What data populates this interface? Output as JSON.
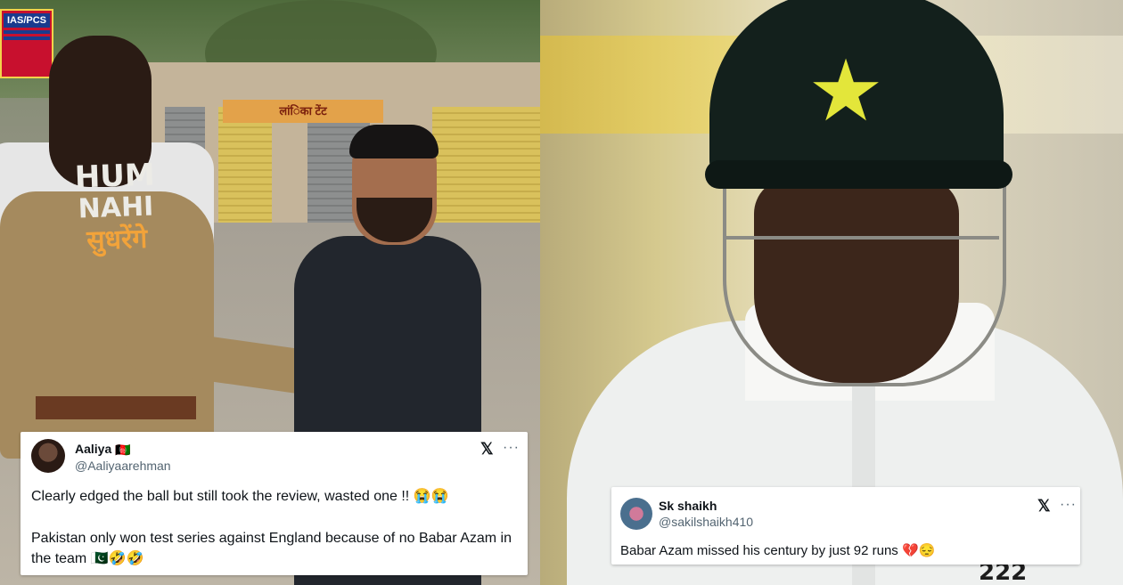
{
  "left_photo": {
    "ias_sign": [
      "IAS/PCS",
      "",
      ""
    ],
    "shop_sign": "लांिका टेंट",
    "tshirt": {
      "line1": "HUM",
      "line2": "NAHI",
      "line3": "सुधरेंगे"
    }
  },
  "right_photo": {
    "jersey_number": "222"
  },
  "tweets": [
    {
      "name": "Aaliya",
      "name_flag": "🇦🇫",
      "handle": "@Aaliyaarehman",
      "x_icon": "𝕏",
      "more": "···",
      "paragraphs": [
        "Clearly edged the ball but still took the review, wasted one !! 😭😭",
        "Pakistan only won test series against England because of no Babar Azam in the team  🇵🇰🤣🤣"
      ]
    },
    {
      "name": "Sk shaikh",
      "handle": "@sakilshaikh410",
      "x_icon": "𝕏",
      "more": "···",
      "paragraphs": [
        "Babar Azam missed his century by just 92 runs 💔😔"
      ]
    }
  ]
}
